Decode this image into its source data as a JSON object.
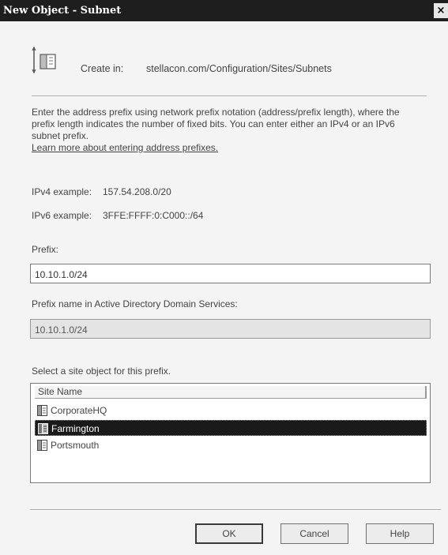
{
  "window": {
    "title": "New Object - Subnet",
    "close_glyph": "×"
  },
  "create_in": {
    "label": "Create in:",
    "path": "stellacon.com/Configuration/Sites/Subnets",
    "icon": "folder-icon"
  },
  "description": {
    "text": "Enter the address prefix using network prefix notation (address/prefix length), where the prefix length indicates the number of fixed bits. You can enter either an IPv4 or an IPv6 subnet prefix.",
    "link": "Learn more about entering address prefixes."
  },
  "examples": {
    "ipv4_label": "IPv4 example:",
    "ipv4_value": "157.54.208.0/20",
    "ipv6_label": "IPv6 example:",
    "ipv6_value": "3FFE:FFFF:0:C000::/64"
  },
  "prefix": {
    "label": "Prefix:",
    "value": "10.10.1.0/24"
  },
  "prefix_name": {
    "label": "Prefix name in Active Directory Domain Services:",
    "value": "10.10.1.0/24"
  },
  "sites": {
    "label": "Select a site object for this prefix.",
    "column": "Site Name",
    "items": [
      {
        "name": "CorporateHQ",
        "selected": false
      },
      {
        "name": "Farmington",
        "selected": true
      },
      {
        "name": "Portsmouth",
        "selected": false
      }
    ]
  },
  "buttons": {
    "ok": "OK",
    "cancel": "Cancel",
    "help": "Help"
  }
}
